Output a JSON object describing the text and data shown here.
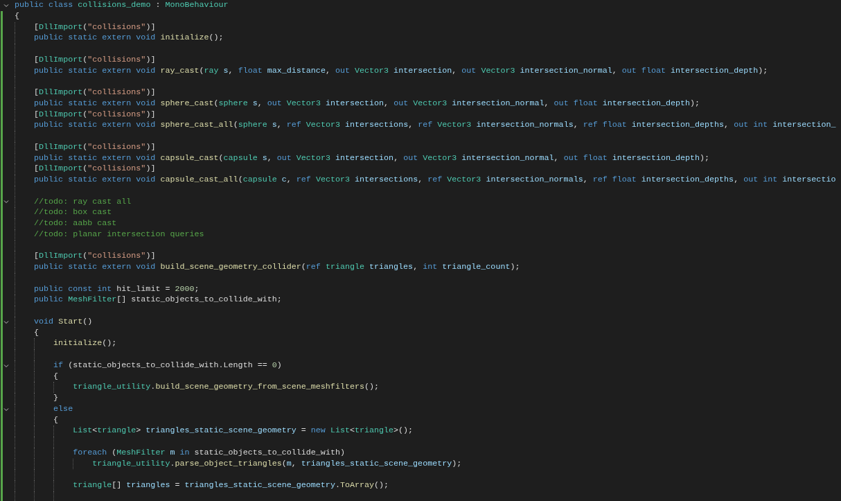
{
  "editor": {
    "lines": [
      {
        "modified": false,
        "fold": {
          "expanded": true
        },
        "tokens": [
          {
            "kind": "kw",
            "text": "public class "
          },
          {
            "kind": "type",
            "text": "collisions_demo"
          },
          {
            "kind": "plain",
            "text": " : "
          },
          {
            "kind": "type",
            "text": "MonoBehaviour"
          }
        ]
      },
      {
        "modified": true,
        "tokens": [
          {
            "kind": "plain",
            "text": "{"
          }
        ],
        "children": [
          {
            "modified": true,
            "tokens": [
              {
                "kind": "plain",
                "text": "["
              },
              {
                "kind": "type",
                "text": "DllImport"
              },
              {
                "kind": "plain",
                "text": "("
              },
              {
                "kind": "str",
                "text": "\"collisions\""
              },
              {
                "kind": "plain",
                "text": ")]"
              }
            ]
          },
          {
            "modified": true,
            "tokens": [
              {
                "kind": "kw",
                "text": "public static extern void "
              },
              {
                "kind": "fn",
                "text": "initialize"
              },
              {
                "kind": "plain",
                "text": "();"
              }
            ]
          },
          {
            "modified": true
          },
          {
            "modified": true,
            "tokens": [
              {
                "kind": "plain",
                "text": "["
              },
              {
                "kind": "type",
                "text": "DllImport"
              },
              {
                "kind": "plain",
                "text": "("
              },
              {
                "kind": "str",
                "text": "\"collisions\""
              },
              {
                "kind": "plain",
                "text": ")]"
              }
            ]
          },
          {
            "modified": true,
            "tokens": [
              {
                "kind": "kw",
                "text": "public static extern void "
              },
              {
                "kind": "fn",
                "text": "ray_cast"
              },
              {
                "kind": "plain",
                "text": "("
              },
              {
                "kind": "type",
                "text": "ray"
              },
              {
                "kind": "var",
                "text": " s"
              },
              {
                "kind": "plain",
                "text": ", "
              },
              {
                "kind": "kw",
                "text": "float"
              },
              {
                "kind": "var",
                "text": " max_distance"
              },
              {
                "kind": "plain",
                "text": ", "
              },
              {
                "kind": "kw",
                "text": "out "
              },
              {
                "kind": "type",
                "text": "Vector3"
              },
              {
                "kind": "var",
                "text": " intersection"
              },
              {
                "kind": "plain",
                "text": ", "
              },
              {
                "kind": "kw",
                "text": "out "
              },
              {
                "kind": "type",
                "text": "Vector3"
              },
              {
                "kind": "var",
                "text": " intersection_normal"
              },
              {
                "kind": "plain",
                "text": ", "
              },
              {
                "kind": "kw",
                "text": "out float"
              },
              {
                "kind": "var",
                "text": " intersection_depth"
              },
              {
                "kind": "plain",
                "text": ");"
              }
            ]
          },
          {
            "modified": true
          },
          {
            "modified": true,
            "tokens": [
              {
                "kind": "plain",
                "text": "["
              },
              {
                "kind": "type",
                "text": "DllImport"
              },
              {
                "kind": "plain",
                "text": "("
              },
              {
                "kind": "str",
                "text": "\"collisions\""
              },
              {
                "kind": "plain",
                "text": ")]"
              }
            ]
          },
          {
            "modified": true,
            "tokens": [
              {
                "kind": "kw",
                "text": "public static extern void "
              },
              {
                "kind": "fn",
                "text": "sphere_cast"
              },
              {
                "kind": "plain",
                "text": "("
              },
              {
                "kind": "type",
                "text": "sphere"
              },
              {
                "kind": "var",
                "text": " s"
              },
              {
                "kind": "plain",
                "text": ", "
              },
              {
                "kind": "kw",
                "text": "out "
              },
              {
                "kind": "type",
                "text": "Vector3"
              },
              {
                "kind": "var",
                "text": " intersection"
              },
              {
                "kind": "plain",
                "text": ", "
              },
              {
                "kind": "kw",
                "text": "out "
              },
              {
                "kind": "type",
                "text": "Vector3"
              },
              {
                "kind": "var",
                "text": " intersection_normal"
              },
              {
                "kind": "plain",
                "text": ", "
              },
              {
                "kind": "kw",
                "text": "out float"
              },
              {
                "kind": "var",
                "text": " intersection_depth"
              },
              {
                "kind": "plain",
                "text": ");"
              }
            ]
          },
          {
            "modified": true,
            "tokens": [
              {
                "kind": "plain",
                "text": "["
              },
              {
                "kind": "type",
                "text": "DllImport"
              },
              {
                "kind": "plain",
                "text": "("
              },
              {
                "kind": "str",
                "text": "\"collisions\""
              },
              {
                "kind": "plain",
                "text": ")]"
              }
            ]
          },
          {
            "modified": true,
            "tokens": [
              {
                "kind": "kw",
                "text": "public static extern void "
              },
              {
                "kind": "fn",
                "text": "sphere_cast_all"
              },
              {
                "kind": "plain",
                "text": "("
              },
              {
                "kind": "type",
                "text": "sphere"
              },
              {
                "kind": "var",
                "text": " s"
              },
              {
                "kind": "plain",
                "text": ", "
              },
              {
                "kind": "kw",
                "text": "ref "
              },
              {
                "kind": "type",
                "text": "Vector3"
              },
              {
                "kind": "var",
                "text": " intersections"
              },
              {
                "kind": "plain",
                "text": ", "
              },
              {
                "kind": "kw",
                "text": "ref "
              },
              {
                "kind": "type",
                "text": "Vector3"
              },
              {
                "kind": "var",
                "text": " intersection_normals"
              },
              {
                "kind": "plain",
                "text": ", "
              },
              {
                "kind": "kw",
                "text": "ref float"
              },
              {
                "kind": "var",
                "text": " intersection_depths"
              },
              {
                "kind": "plain",
                "text": ", "
              },
              {
                "kind": "kw",
                "text": "out int"
              },
              {
                "kind": "var",
                "text": " intersection_"
              }
            ]
          },
          {
            "modified": true
          },
          {
            "modified": true,
            "tokens": [
              {
                "kind": "plain",
                "text": "["
              },
              {
                "kind": "type",
                "text": "DllImport"
              },
              {
                "kind": "plain",
                "text": "("
              },
              {
                "kind": "str",
                "text": "\"collisions\""
              },
              {
                "kind": "plain",
                "text": ")]"
              }
            ]
          },
          {
            "modified": true,
            "tokens": [
              {
                "kind": "kw",
                "text": "public static extern void "
              },
              {
                "kind": "fn",
                "text": "capsule_cast"
              },
              {
                "kind": "plain",
                "text": "("
              },
              {
                "kind": "type",
                "text": "capsule"
              },
              {
                "kind": "var",
                "text": " s"
              },
              {
                "kind": "plain",
                "text": ", "
              },
              {
                "kind": "kw",
                "text": "out "
              },
              {
                "kind": "type",
                "text": "Vector3"
              },
              {
                "kind": "var",
                "text": " intersection"
              },
              {
                "kind": "plain",
                "text": ", "
              },
              {
                "kind": "kw",
                "text": "out "
              },
              {
                "kind": "type",
                "text": "Vector3"
              },
              {
                "kind": "var",
                "text": " intersection_normal"
              },
              {
                "kind": "plain",
                "text": ", "
              },
              {
                "kind": "kw",
                "text": "out float"
              },
              {
                "kind": "var",
                "text": " intersection_depth"
              },
              {
                "kind": "plain",
                "text": ");"
              }
            ]
          },
          {
            "modified": true,
            "tokens": [
              {
                "kind": "plain",
                "text": "["
              },
              {
                "kind": "type",
                "text": "DllImport"
              },
              {
                "kind": "plain",
                "text": "("
              },
              {
                "kind": "str",
                "text": "\"collisions\""
              },
              {
                "kind": "plain",
                "text": ")]"
              }
            ]
          },
          {
            "modified": true,
            "tokens": [
              {
                "kind": "kw",
                "text": "public static extern void "
              },
              {
                "kind": "fn",
                "text": "capsule_cast_all"
              },
              {
                "kind": "plain",
                "text": "("
              },
              {
                "kind": "type",
                "text": "capsule"
              },
              {
                "kind": "var",
                "text": " c"
              },
              {
                "kind": "plain",
                "text": ", "
              },
              {
                "kind": "kw",
                "text": "ref "
              },
              {
                "kind": "type",
                "text": "Vector3"
              },
              {
                "kind": "var",
                "text": " intersections"
              },
              {
                "kind": "plain",
                "text": ", "
              },
              {
                "kind": "kw",
                "text": "ref "
              },
              {
                "kind": "type",
                "text": "Vector3"
              },
              {
                "kind": "var",
                "text": " intersection_normals"
              },
              {
                "kind": "plain",
                "text": ", "
              },
              {
                "kind": "kw",
                "text": "ref float"
              },
              {
                "kind": "var",
                "text": " intersection_depths"
              },
              {
                "kind": "plain",
                "text": ", "
              },
              {
                "kind": "kw",
                "text": "out int"
              },
              {
                "kind": "var",
                "text": " intersectio"
              }
            ]
          },
          {
            "modified": true
          },
          {
            "modified": true,
            "fold": {
              "expanded": true
            },
            "tokens": [
              {
                "kind": "cmt",
                "text": "//todo: ray cast all"
              }
            ]
          },
          {
            "modified": true,
            "tokens": [
              {
                "kind": "cmt",
                "text": "//todo: box cast"
              }
            ]
          },
          {
            "modified": true,
            "tokens": [
              {
                "kind": "cmt",
                "text": "//todo: aabb cast"
              }
            ]
          },
          {
            "modified": true,
            "tokens": [
              {
                "kind": "cmt",
                "text": "//todo: planar intersection queries"
              }
            ]
          },
          {
            "modified": true
          },
          {
            "modified": true,
            "tokens": [
              {
                "kind": "plain",
                "text": "["
              },
              {
                "kind": "type",
                "text": "DllImport"
              },
              {
                "kind": "plain",
                "text": "("
              },
              {
                "kind": "str",
                "text": "\"collisions\""
              },
              {
                "kind": "plain",
                "text": ")]"
              }
            ]
          },
          {
            "modified": true,
            "tokens": [
              {
                "kind": "kw",
                "text": "public static extern void "
              },
              {
                "kind": "fn",
                "text": "build_scene_geometry_collider"
              },
              {
                "kind": "plain",
                "text": "("
              },
              {
                "kind": "kw",
                "text": "ref "
              },
              {
                "kind": "type",
                "text": "triangle"
              },
              {
                "kind": "var",
                "text": " triangles"
              },
              {
                "kind": "plain",
                "text": ", "
              },
              {
                "kind": "kw",
                "text": "int"
              },
              {
                "kind": "var",
                "text": " triangle_count"
              },
              {
                "kind": "plain",
                "text": ");"
              }
            ]
          },
          {
            "modified": true
          },
          {
            "modified": true,
            "tokens": [
              {
                "kind": "kw",
                "text": "public const int "
              },
              {
                "kind": "plain",
                "text": "hit_limit = "
              },
              {
                "kind": "num",
                "text": "2000"
              },
              {
                "kind": "plain",
                "text": ";"
              }
            ]
          },
          {
            "modified": true,
            "tokens": [
              {
                "kind": "kw",
                "text": "public "
              },
              {
                "kind": "type",
                "text": "MeshFilter"
              },
              {
                "kind": "plain",
                "text": "[] static_objects_to_collide_with;"
              }
            ]
          },
          {
            "modified": true
          },
          {
            "modified": true,
            "fold": {
              "expanded": true
            },
            "tokens": [
              {
                "kind": "kw",
                "text": "void "
              },
              {
                "kind": "fn",
                "text": "Start"
              },
              {
                "kind": "plain",
                "text": "()"
              }
            ]
          },
          {
            "modified": true,
            "tokens": [
              {
                "kind": "plain",
                "text": "{"
              }
            ],
            "children": [
              {
                "modified": true,
                "tokens": [
                  {
                    "kind": "fn",
                    "text": "initialize"
                  },
                  {
                    "kind": "plain",
                    "text": "();"
                  }
                ]
              },
              {
                "modified": true
              },
              {
                "modified": true,
                "fold": {
                  "expanded": true
                },
                "tokens": [
                  {
                    "kind": "kw",
                    "text": "if"
                  },
                  {
                    "kind": "plain",
                    "text": " (static_objects_to_collide_with.Length == "
                  },
                  {
                    "kind": "num",
                    "text": "0"
                  },
                  {
                    "kind": "plain",
                    "text": ")"
                  }
                ]
              },
              {
                "modified": true,
                "tokens": [
                  {
                    "kind": "plain",
                    "text": "{"
                  }
                ],
                "children": [
                  {
                    "modified": true,
                    "tokens": [
                      {
                        "kind": "type",
                        "text": "triangle_utility"
                      },
                      {
                        "kind": "plain",
                        "text": "."
                      },
                      {
                        "kind": "fn",
                        "text": "build_scene_geometry_from_scene_meshfilters"
                      },
                      {
                        "kind": "plain",
                        "text": "();"
                      }
                    ]
                  }
                ]
              },
              {
                "modified": true,
                "tokens": [
                  {
                    "kind": "plain",
                    "text": "}"
                  }
                ]
              },
              {
                "modified": true,
                "fold": {
                  "expanded": true
                },
                "tokens": [
                  {
                    "kind": "kw",
                    "text": "else"
                  }
                ]
              },
              {
                "modified": true,
                "tokens": [
                  {
                    "kind": "plain",
                    "text": "{"
                  }
                ],
                "children": [
                  {
                    "modified": true,
                    "tokens": [
                      {
                        "kind": "type",
                        "text": "List"
                      },
                      {
                        "kind": "plain",
                        "text": "<"
                      },
                      {
                        "kind": "type",
                        "text": "triangle"
                      },
                      {
                        "kind": "plain",
                        "text": ">"
                      },
                      {
                        "kind": "var",
                        "text": " triangles_static_scene_geometry"
                      },
                      {
                        "kind": "plain",
                        "text": " = "
                      },
                      {
                        "kind": "kw",
                        "text": "new "
                      },
                      {
                        "kind": "type",
                        "text": "List"
                      },
                      {
                        "kind": "plain",
                        "text": "<"
                      },
                      {
                        "kind": "type",
                        "text": "triangle"
                      },
                      {
                        "kind": "plain",
                        "text": ">();"
                      }
                    ]
                  },
                  {
                    "modified": true
                  },
                  {
                    "modified": true,
                    "tokens": [
                      {
                        "kind": "kw",
                        "text": "foreach"
                      },
                      {
                        "kind": "plain",
                        "text": " ("
                      },
                      {
                        "kind": "type",
                        "text": "MeshFilter"
                      },
                      {
                        "kind": "var",
                        "text": " m"
                      },
                      {
                        "kind": "kw",
                        "text": " in"
                      },
                      {
                        "kind": "plain",
                        "text": " static_objects_to_collide_with)"
                      }
                    ],
                    "children": [
                      {
                        "modified": true,
                        "tokens": [
                          {
                            "kind": "type",
                            "text": "triangle_utility"
                          },
                          {
                            "kind": "plain",
                            "text": "."
                          },
                          {
                            "kind": "fn",
                            "text": "parse_object_triangles"
                          },
                          {
                            "kind": "plain",
                            "text": "("
                          },
                          {
                            "kind": "var",
                            "text": "m"
                          },
                          {
                            "kind": "plain",
                            "text": ", "
                          },
                          {
                            "kind": "var",
                            "text": "triangles_static_scene_geometry"
                          },
                          {
                            "kind": "plain",
                            "text": ");"
                          }
                        ]
                      }
                    ]
                  },
                  {
                    "modified": true
                  },
                  {
                    "modified": true,
                    "tokens": [
                      {
                        "kind": "type",
                        "text": "triangle"
                      },
                      {
                        "kind": "plain",
                        "text": "[]"
                      },
                      {
                        "kind": "var",
                        "text": " triangles"
                      },
                      {
                        "kind": "plain",
                        "text": " = "
                      },
                      {
                        "kind": "var",
                        "text": "triangles_static_scene_geometry"
                      },
                      {
                        "kind": "plain",
                        "text": "."
                      },
                      {
                        "kind": "fn",
                        "text": "ToArray"
                      },
                      {
                        "kind": "plain",
                        "text": "();"
                      }
                    ]
                  },
                  {
                    "modified": true
                  }
                ]
              }
            ]
          }
        ]
      }
    ]
  }
}
